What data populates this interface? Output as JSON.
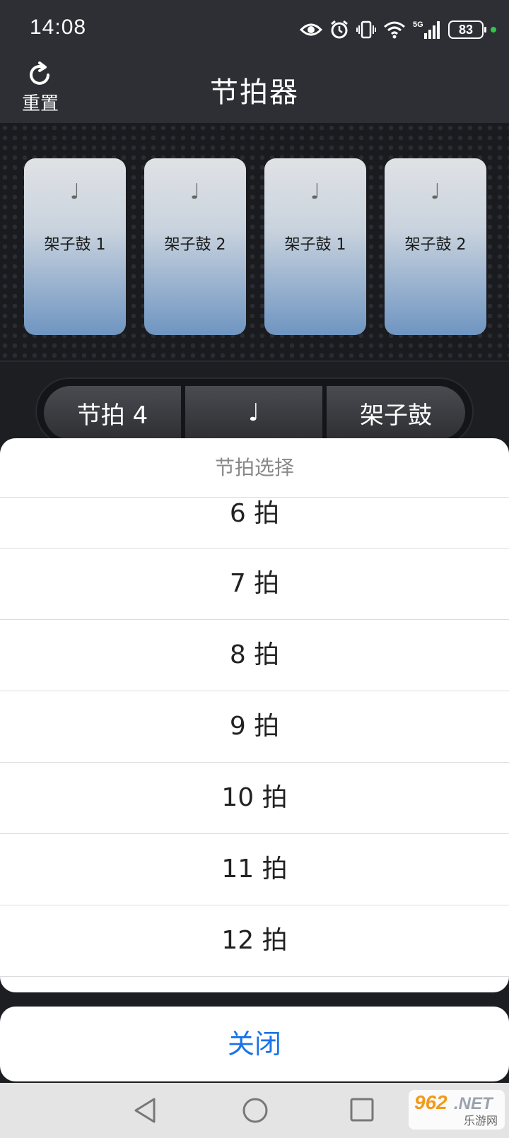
{
  "status_bar": {
    "time": "14:08",
    "battery": "83",
    "network": "5G",
    "icons": [
      "eye-icon",
      "alarm-icon",
      "vibrate-icon",
      "wifi-icon",
      "signal-icon",
      "battery-icon"
    ]
  },
  "header": {
    "reset_label": "重置",
    "title": "节拍器"
  },
  "beats": [
    {
      "note": "♩",
      "label": "架子鼓 1"
    },
    {
      "note": "♩",
      "label": "架子鼓 2"
    },
    {
      "note": "♩",
      "label": "架子鼓 1"
    },
    {
      "note": "♩",
      "label": "架子鼓 2"
    }
  ],
  "controls": {
    "beat": "节拍 4",
    "note": "♩",
    "sound": "架子鼓"
  },
  "sheet": {
    "title": "节拍选择",
    "options": [
      "6 拍",
      "7 拍",
      "8 拍",
      "9 拍",
      "10 拍",
      "11 拍",
      "12 拍"
    ],
    "close_label": "关闭"
  },
  "watermark": {
    "top": "962",
    "net": ".NET",
    "sub": "乐游网"
  },
  "colors": {
    "accent": "#1a73e8",
    "card_top": "#e0e2e5",
    "card_bottom": "#6f95c1",
    "header_bg": "#2e2f34"
  }
}
